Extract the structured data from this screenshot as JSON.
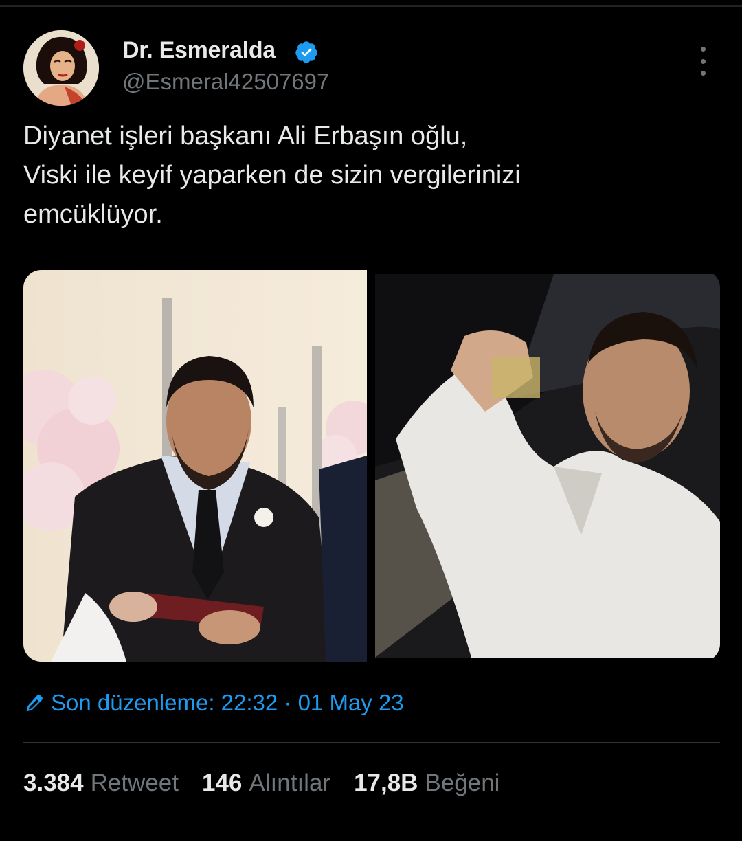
{
  "author": {
    "display_name": "Dr. Esmeralda",
    "handle": "@Esmeral42507697",
    "verified": true,
    "avatar_icon": "avatar-portrait"
  },
  "tweet": {
    "text_lines": [
      "Diyanet işleri başkanı Ali Erbaşın oğlu,",
      "Viski ile keyif yaparken de sizin vergilerinizi",
      "emcüklüyor."
    ]
  },
  "edited": {
    "icon": "pencil-icon",
    "text": "Son düzenleme: 22:32 · 01 May 23"
  },
  "stats": [
    {
      "value": "3.384",
      "label": "Retweet"
    },
    {
      "value": "146",
      "label": "Alıntılar"
    },
    {
      "value": "17,8B",
      "label": "Beğeni"
    }
  ],
  "colors": {
    "background": "#000000",
    "text": "#e7e9ea",
    "secondary": "#71767b",
    "accent": "#1d9bf0",
    "divider": "#2f3336"
  }
}
